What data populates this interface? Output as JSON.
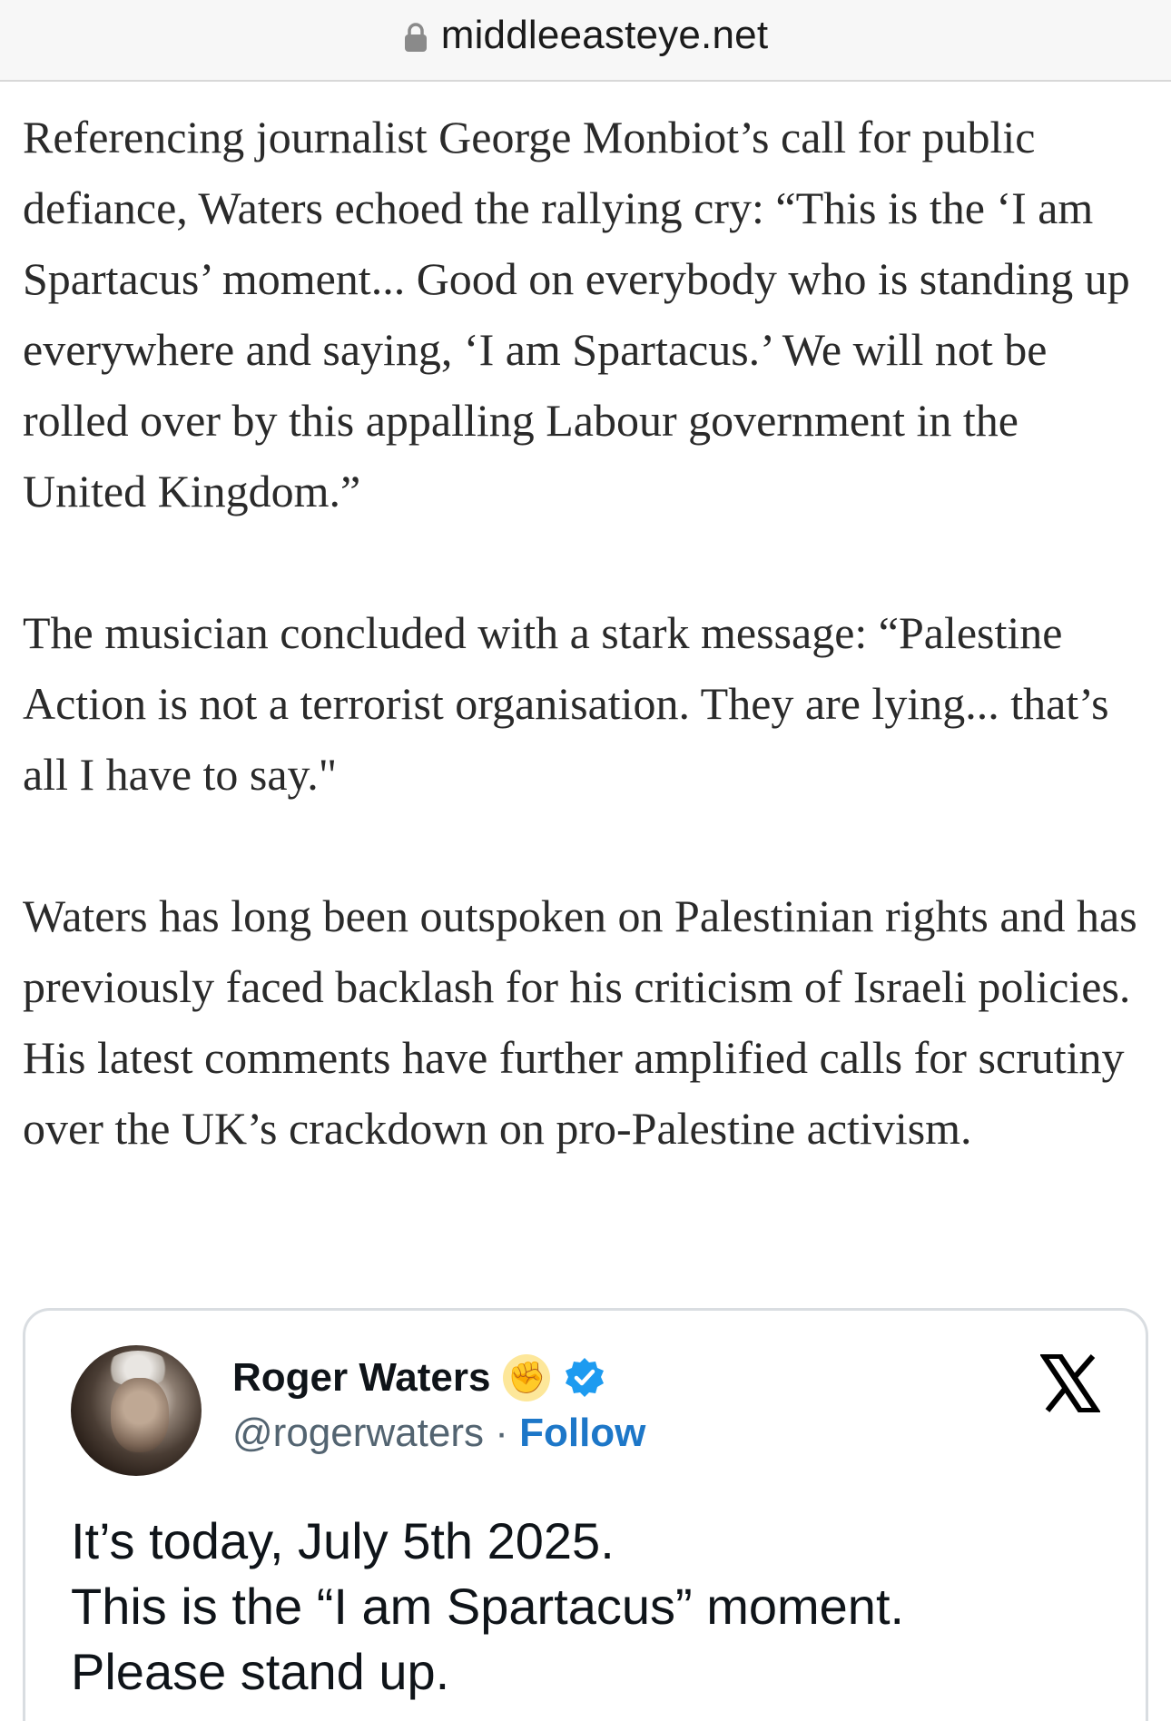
{
  "browser": {
    "domain": "middleeasteye.net",
    "lock_icon": "lock-icon"
  },
  "article": {
    "paragraphs": [
      "Referencing journalist George Monbiot’s call for public defiance, Waters echoed the rallying cry: “This is the ‘I am Spartacus’ moment... Good on everybody who is standing up everywhere and saying, ‘I am Spartacus.’ We will not be rolled over by this appalling Labour government in the United Kingdom.”",
      "The musician concluded with a stark message: “Palestine Action is not a terrorist organisation. They are lying... that’s all I have to say.\"",
      "Waters has long been outspoken on Palestinian rights and has previously faced backlash for his criticism of Israeli policies. His latest comments have further amplified calls for scrutiny over the UK’s crackdown on pro-Palestine activism."
    ]
  },
  "tweet": {
    "author_name": "Roger Waters",
    "handle": "@rogerwaters",
    "separator": " · ",
    "follow_label": "Follow",
    "icons": [
      "raised-fist-icon",
      "verified-badge-icon",
      "x-logo-icon"
    ],
    "text_lines": [
      "It’s today, July 5th 2025.",
      "This is the “I am Spartacus” moment.",
      "Please stand up."
    ],
    "colors": {
      "follow": "#1d77c8",
      "verified": "#1d9bf0",
      "fist": "#fde79a"
    }
  }
}
